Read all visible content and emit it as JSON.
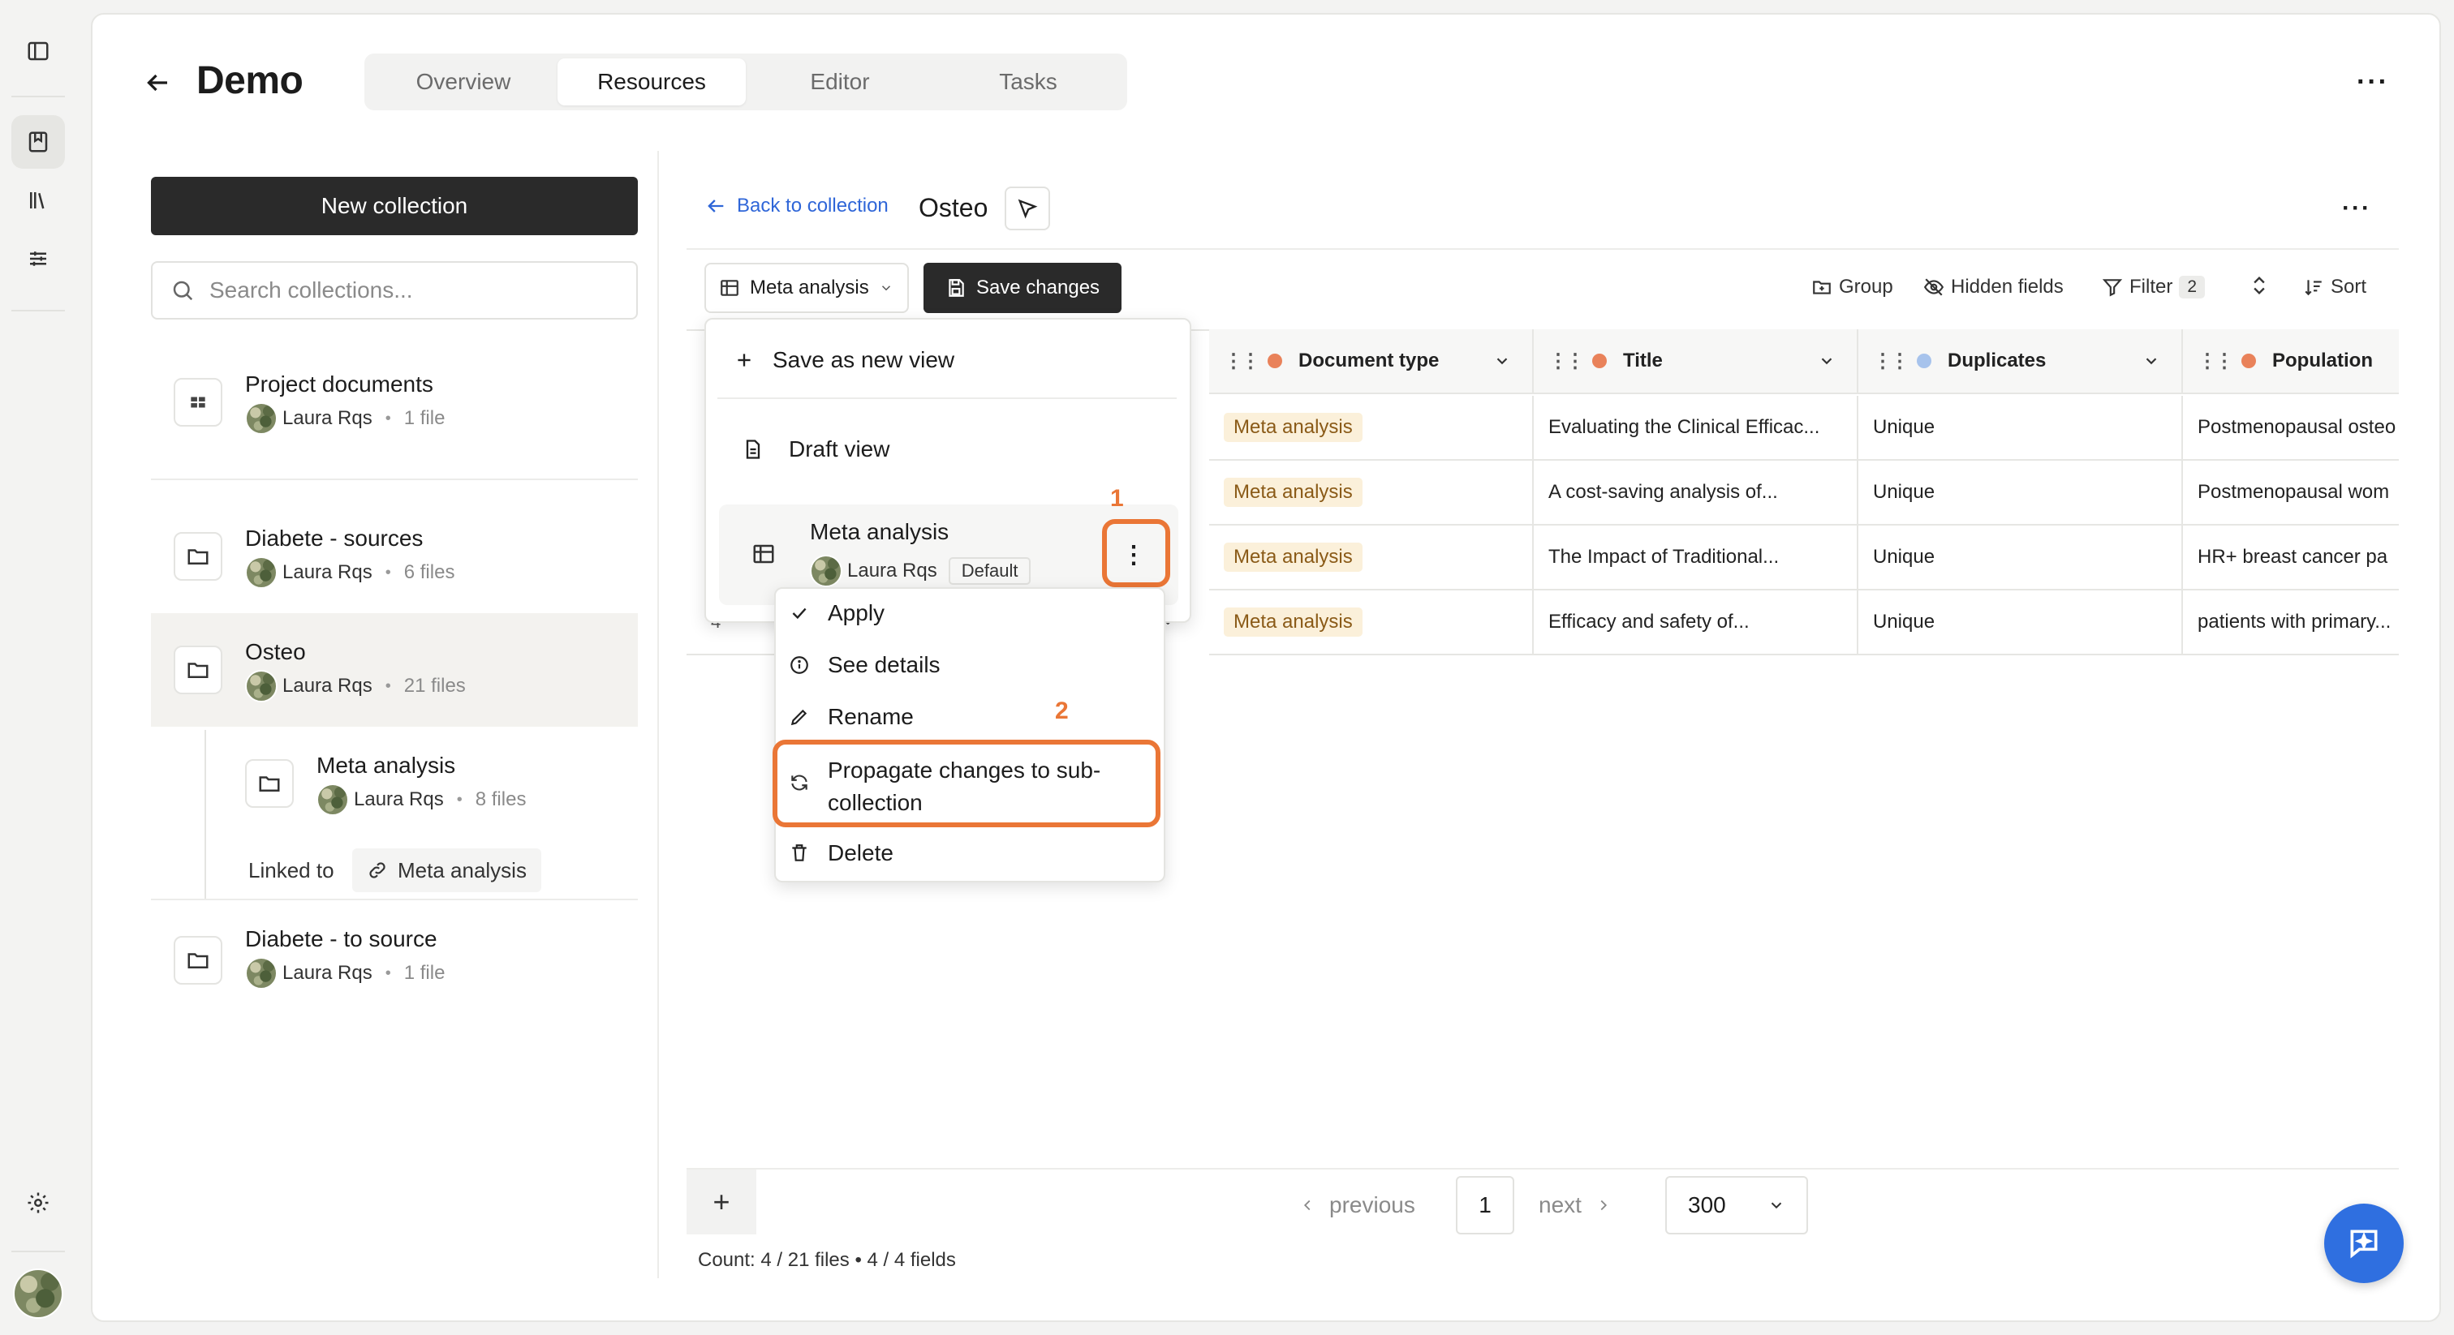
{
  "header": {
    "title": "Demo",
    "tabs": [
      "Overview",
      "Resources",
      "Editor",
      "Tasks"
    ],
    "active_tab": "Resources"
  },
  "sidebar": {
    "new_collection_label": "New collection",
    "search_placeholder": "Search collections...",
    "collections": [
      {
        "name": "Project documents",
        "owner": "Laura Rqs",
        "files": "1 file"
      },
      {
        "name": "Diabete - sources",
        "owner": "Laura Rqs",
        "files": "6 files"
      },
      {
        "name": "Osteo",
        "owner": "Laura Rqs",
        "files": "21 files"
      },
      {
        "name": "Meta analysis",
        "owner": "Laura Rqs",
        "files": "8 files"
      },
      {
        "name": "Diabete - to source",
        "owner": "Laura Rqs",
        "files": "1 file"
      }
    ],
    "linked_to_label": "Linked to",
    "linked_to_value": "Meta analysis"
  },
  "panel": {
    "back_label": "Back to collection",
    "collection_title": "Osteo",
    "view_select_label": "Meta analysis",
    "save_changes_label": "Save changes",
    "toolbar": {
      "group": "Group",
      "hidden_fields": "Hidden fields",
      "filter": "Filter",
      "filter_count": "2",
      "sort": "Sort"
    }
  },
  "table": {
    "columns": [
      "Document type",
      "Title",
      "Duplicates",
      "Population"
    ],
    "column_colors": [
      "#e9825a",
      "#e9825a",
      "#8fb3e8",
      "#e9825a"
    ],
    "row_number_visible": "4",
    "rows": [
      {
        "type": "Meta analysis",
        "title": "Evaluating the Clinical Efficac...",
        "dup": "Unique",
        "pop": "Postmenopausal osteo"
      },
      {
        "type": "Meta analysis",
        "title": "A cost-saving analysis of...",
        "dup": "Unique",
        "pop": "Postmenopausal wom"
      },
      {
        "type": "Meta analysis",
        "title": "The Impact of Traditional...",
        "dup": "Unique",
        "pop": "HR+ breast cancer pa"
      },
      {
        "type": "Meta analysis",
        "title": "Efficacy and safety of...",
        "dup": "Unique",
        "pop": "patients with primary..."
      }
    ]
  },
  "views_menu": {
    "save_as_new": "Save as new view",
    "draft_view": "Draft view",
    "meta_view_name": "Meta analysis",
    "meta_view_owner": "Laura Rqs",
    "default_badge": "Default"
  },
  "context_menu": {
    "items": [
      "Apply",
      "See details",
      "Rename",
      "Propagate changes to sub-",
      "collection",
      "Delete"
    ]
  },
  "annotations": {
    "one": "1",
    "two": "2"
  },
  "pagination": {
    "add_label": "+",
    "previous": "previous",
    "page": "1",
    "next": "next",
    "page_size": "300"
  },
  "footer": {
    "count_text": "Count: 4 / 21 files • 4 / 4 fields"
  }
}
